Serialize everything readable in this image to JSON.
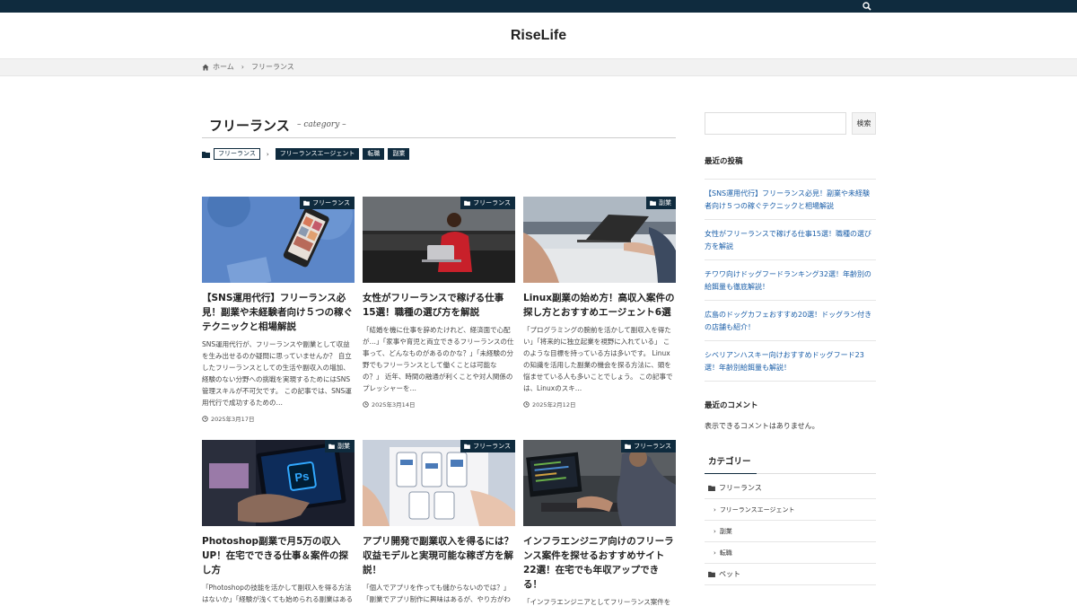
{
  "site": {
    "title": "RiseLife"
  },
  "breadcrumb": {
    "home": "ホーム",
    "current": "フリーランス"
  },
  "page": {
    "title": "フリーランス",
    "subtitle": "– category –"
  },
  "category_tags": {
    "parent": "フリーランス",
    "children": [
      "フリーランスエージェント",
      "転職",
      "副業"
    ]
  },
  "posts": [
    {
      "category": "フリーランス",
      "title": "【SNS運用代行】フリーランス必見！副業や未経験者向け５つの稼ぐテクニックと相場解説",
      "excerpt": "SNS運用代行が、フリーランスや副業として収益を生み出せるのか疑問に思っていませんか？ 自立したフリーランスとしての生活や副収入の増加、経験のない分野への挑戦を実現するためにはSNS管理スキルが不可欠です。 この記事では、SNS運用代行で成功するための…",
      "date": "2025年3月17日"
    },
    {
      "category": "フリーランス",
      "title": "女性がフリーランスで稼げる仕事15選！職種の選び方を解説",
      "excerpt": "「結婚を機に仕事を辞めたけれど、経済面で心配が…」「家事や育児と両立できるフリーランスの仕事って、どんなものがあるのかな？」「未経験の分野でもフリーランスとして働くことは可能なの？」 近年、時間の融通が利くことや対人関係のプレッシャーを…",
      "date": "2025年3月14日"
    },
    {
      "category": "副業",
      "title": "Linux副業の始め方！高収入案件の探し方とおすすめエージェント6選",
      "excerpt": "「プログラミングの腕前を活かして副収入を得たい」「将来的に独立起業を視野に入れている」 このような目標を持っている方は多いです。 Linuxの知識を活用した副業の機会を探る方法に、頭を悩ませている人も多いことでしょう。 この記事では、Linuxのスキ…",
      "date": "2025年2月12日"
    },
    {
      "category": "副業",
      "title": "Photoshop副業で月5万の収入UP！在宅でできる仕事＆案件の探し方",
      "excerpt": "「Photoshopの技能を活かして副収入を得る方法はないか」「経験が浅くても始められる副業はあるか」と考えている方も多いのではないでしょうか。 Photoshopは画像加工やグラフ",
      "date": ""
    },
    {
      "category": "フリーランス",
      "title": "アプリ開発で副業収入を得るには？収益モデルと実現可能な稼ぎ方を解説！",
      "excerpt": "「個人でアプリを作っても儲からないのでは？」「副業でアプリ制作に興味はあるが、やり方がわからない」「本当に副業として",
      "date": ""
    },
    {
      "category": "フリーランス",
      "title": "インフラエンジニア向けのフリーランス案件を探せるおすすめサイト22選！在宅でも年収アップできる！",
      "excerpt": "「インフラエンジニアとしてフリーランス案件を見つけやすい求人サービスは？」「フリーランスのインフラエンジニア案件がなかなか",
      "date": ""
    }
  ],
  "sidebar": {
    "search_placeholder": "",
    "search_button": "検索",
    "recent_title": "最近の投稿",
    "recent_posts": [
      "【SNS運用代行】フリーランス必見！副業や未経験者向け５つの稼ぐテクニックと相場解説",
      "女性がフリーランスで稼げる仕事15選！職種の選び方を解説",
      "チワワ向けドッグフードランキング32選！年齢別の給餌量も徹底解説！",
      "広島のドッグカフェおすすめ20選！ドッグラン付きの店舗も紹介！",
      "シベリアンハスキー向けおすすめドッグフード23選！年齢別給餌量も解説！"
    ],
    "comments_title": "最近のコメント",
    "comments_empty": "表示できるコメントはありません。",
    "categories_title": "カテゴリー",
    "categories": [
      {
        "label": "フリーランス",
        "level": 0
      },
      {
        "label": "フリーランスエージェント",
        "level": 1
      },
      {
        "label": "副業",
        "level": 1
      },
      {
        "label": "転職",
        "level": 1
      },
      {
        "label": "ペット",
        "level": 0
      }
    ]
  },
  "colors": {
    "primary": "#0f2b3e",
    "link": "#1a5ea8"
  }
}
